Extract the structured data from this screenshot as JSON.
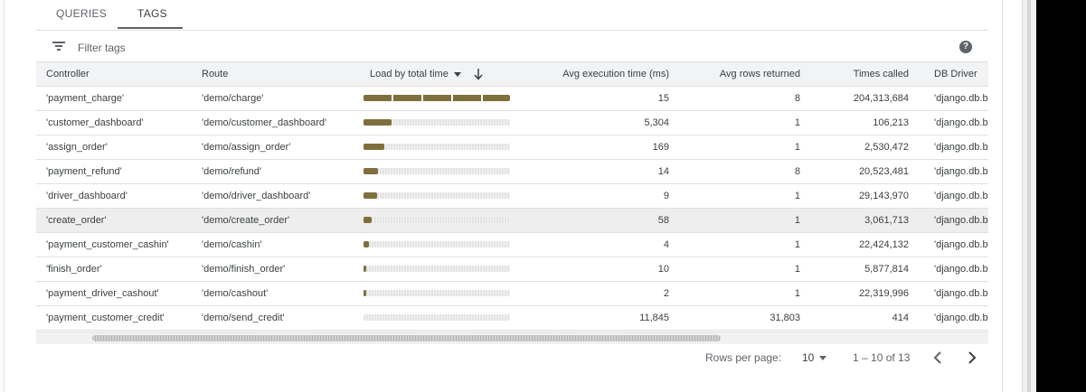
{
  "tabs": [
    {
      "label": "QUERIES",
      "active": false
    },
    {
      "label": "TAGS",
      "active": true
    }
  ],
  "filter": {
    "placeholder": "Filter tags",
    "filter_icon": "filter-list-icon",
    "help_icon": "help-icon",
    "help_glyph": "?"
  },
  "columns": {
    "controller": "Controller",
    "route": "Route",
    "load": "Load by total time",
    "avg_exec": "Avg execution time (ms)",
    "avg_rows": "Avg rows returned",
    "times_called": "Times called",
    "db_driver": "DB Driver"
  },
  "rows": [
    {
      "controller": "'payment_charge'",
      "route": "'demo/charge'",
      "load": 1.0,
      "avg_exec": "15",
      "avg_rows": "8",
      "times_called": "204,313,684",
      "db_driver": "'django.db.backends'"
    },
    {
      "controller": "'customer_dashboard'",
      "route": "'demo/customer_dashboard'",
      "load": 0.19,
      "avg_exec": "5,304",
      "avg_rows": "1",
      "times_called": "106,213",
      "db_driver": "'django.db.backends'"
    },
    {
      "controller": "'assign_order'",
      "route": "'demo/assign_order'",
      "load": 0.14,
      "avg_exec": "169",
      "avg_rows": "1",
      "times_called": "2,530,472",
      "db_driver": "'django.db.backends'"
    },
    {
      "controller": "'payment_refund'",
      "route": "'demo/refund'",
      "load": 0.1,
      "avg_exec": "14",
      "avg_rows": "8",
      "times_called": "20,523,481",
      "db_driver": "'django.db.backends'"
    },
    {
      "controller": "'driver_dashboard'",
      "route": "'demo/driver_dashboard'",
      "load": 0.09,
      "avg_exec": "9",
      "avg_rows": "1",
      "times_called": "29,143,970",
      "db_driver": "'django.db.backends'"
    },
    {
      "controller": "'create_order'",
      "route": "'demo/create_order'",
      "load": 0.055,
      "avg_exec": "58",
      "avg_rows": "1",
      "times_called": "3,061,713",
      "db_driver": "'django.db.backends'",
      "highlight": true
    },
    {
      "controller": "'payment_customer_cashin'",
      "route": "'demo/cashin'",
      "load": 0.035,
      "avg_exec": "4",
      "avg_rows": "1",
      "times_called": "22,424,132",
      "db_driver": "'django.db.backends'"
    },
    {
      "controller": "'finish_order'",
      "route": "'demo/finish_order'",
      "load": 0.02,
      "avg_exec": "10",
      "avg_rows": "1",
      "times_called": "5,877,814",
      "db_driver": "'django.db.backends'"
    },
    {
      "controller": "'payment_driver_cashout'",
      "route": "'demo/cashout'",
      "load": 0.02,
      "avg_exec": "2",
      "avg_rows": "1",
      "times_called": "22,319,996",
      "db_driver": "'django.db.backends'"
    },
    {
      "controller": "'payment_customer_credit'",
      "route": "'demo/send_credit'",
      "load": 0.0,
      "avg_exec": "11,845",
      "avg_rows": "31,803",
      "times_called": "414",
      "db_driver": "'django.db.backends'"
    }
  ],
  "pagination": {
    "rows_per_page_label": "Rows per page:",
    "rows_per_page_value": "10",
    "range": "1 – 10 of 13",
    "prev_icon": "chevron-left-icon",
    "next_icon": "chevron-right-icon"
  },
  "colors": {
    "bar": "#7f6f3c",
    "bar_bg": "#e4e4e4",
    "header_bg": "#f1f3f4"
  }
}
